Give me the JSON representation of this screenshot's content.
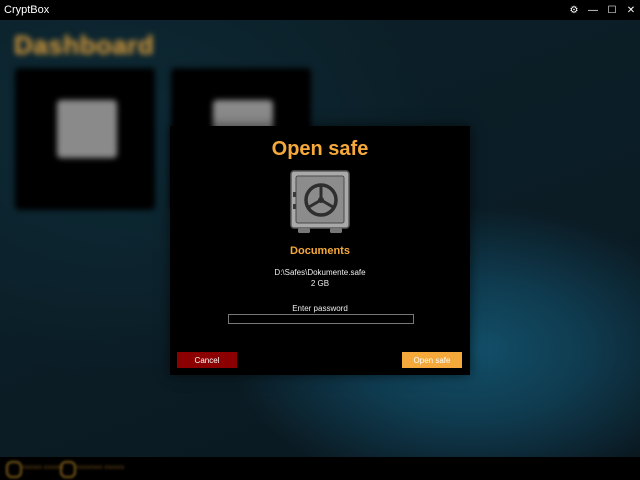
{
  "app": {
    "title": "CryptBox"
  },
  "window_controls": {
    "settings": "⚙",
    "minimize": "—",
    "maximize": "☐",
    "close": "✕"
  },
  "dialog": {
    "title": "Open safe",
    "safe_name": "Documents",
    "path": "D:\\Safes\\Dokumente.safe",
    "size": "2 GB",
    "password_label": "Enter password",
    "password_value": "",
    "cancel_label": "Cancel",
    "open_label": "Open safe"
  },
  "colors": {
    "accent": "#f5a93a",
    "cancel": "#8b0000",
    "titlebar": "#000000"
  },
  "background": {
    "title": "Dashboard"
  }
}
